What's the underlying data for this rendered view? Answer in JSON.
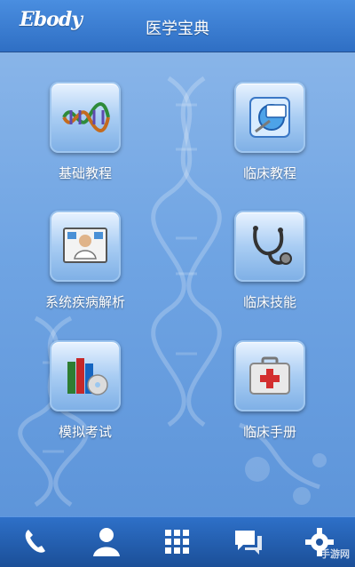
{
  "header": {
    "logo_text": "Ebody",
    "title": "医学宝典"
  },
  "menu": [
    {
      "label": "基础教程",
      "icon": "dna-icon"
    },
    {
      "label": "临床教程",
      "icon": "clinical-tablet-icon"
    },
    {
      "label": "系统疾病解析",
      "icon": "doctor-presentation-icon"
    },
    {
      "label": "临床技能",
      "icon": "stethoscope-icon"
    },
    {
      "label": "模拟考试",
      "icon": "books-cd-icon"
    },
    {
      "label": "临床手册",
      "icon": "first-aid-kit-icon"
    }
  ],
  "bottom_bar": [
    {
      "icon": "phone-icon"
    },
    {
      "icon": "user-icon"
    },
    {
      "icon": "grid-icon"
    },
    {
      "icon": "chat-icon"
    },
    {
      "icon": "settings-gear-icon"
    }
  ],
  "colors": {
    "header": "#2f6fc4",
    "background": "#6fa4e3",
    "bottom_bar": "#1b4f98",
    "text": "#ffffff"
  },
  "watermark": "手游网"
}
